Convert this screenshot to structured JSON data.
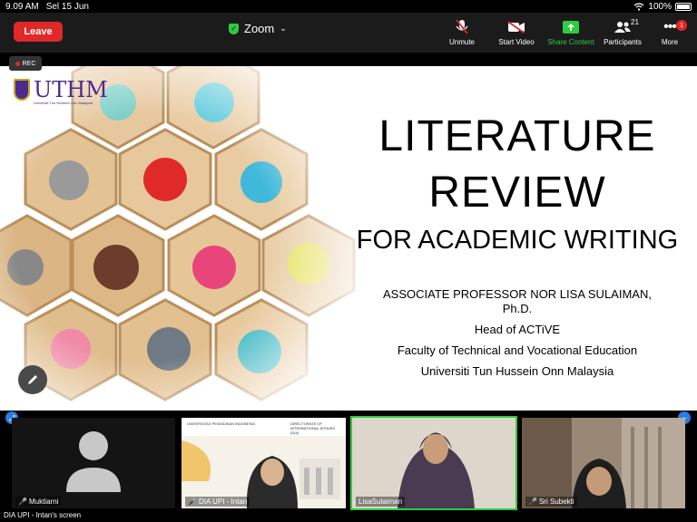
{
  "status_bar": {
    "time": "9.09 AM",
    "date": "Sel 15 Jun",
    "battery": "100%"
  },
  "toolbar": {
    "leave_label": "Leave",
    "meeting_title": "Zoom",
    "unmute_label": "Unmute",
    "start_video_label": "Start Video",
    "share_content_label": "Share Content",
    "participants_label": "Participants",
    "participants_count": "21",
    "more_label": "More",
    "more_badge": "1"
  },
  "rec_label": "REC",
  "slide": {
    "logo_text": "UTHM",
    "logo_subtitle": "Universiti Tun Hussein Onn Malaysia",
    "title_line1": "LITERATURE",
    "title_line2": "REVIEW",
    "subtitle": "FOR ACADEMIC WRITING",
    "presenter_line1": "ASSOCIATE PROFESSOR NOR LISA SULAIMAN,",
    "presenter_line2": "Ph.D.",
    "role": "Head of ACTiVE",
    "faculty": "Faculty of Technical and Vocational  Education",
    "university": "Universiti Tun Hussein Onn Malaysia"
  },
  "participants": [
    {
      "name": "Muktiarni",
      "muted": true,
      "video": false
    },
    {
      "name": "DIA UPI - Intan",
      "muted": true,
      "video": true
    },
    {
      "name": "LisaSulaiman",
      "muted": false,
      "video": true,
      "active": true
    },
    {
      "name": "Sri Subekti",
      "muted": true,
      "video": true
    }
  ],
  "tile2_header": {
    "left": "UNIVERSITAS PENDIDIKAN INDONESIA",
    "right": "DIRECTORATE OF INTERNATIONAL AFFAIRS (DIA)"
  },
  "screen_share_label": "DIA UPI - Intan's screen"
}
